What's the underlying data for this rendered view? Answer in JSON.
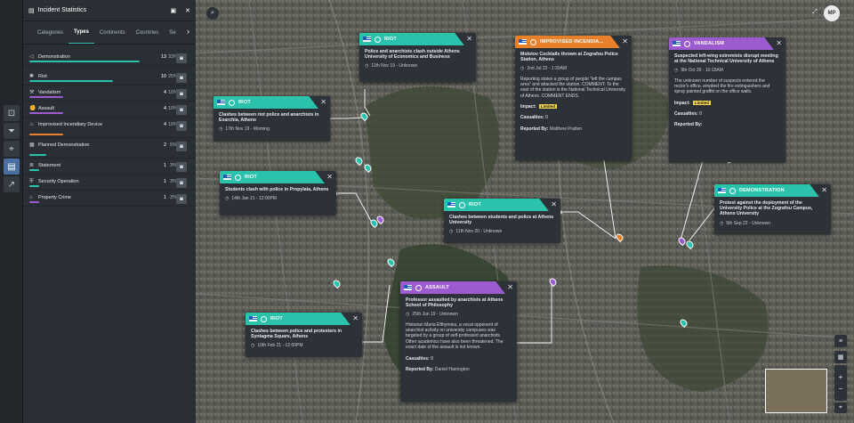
{
  "panel": {
    "title": "Incident Statistics",
    "tabs": [
      {
        "label": "Categories",
        "active": false
      },
      {
        "label": "Types",
        "active": true
      },
      {
        "label": "Continents",
        "active": false
      },
      {
        "label": "Countries",
        "active": false
      },
      {
        "label": "Se",
        "active": false
      }
    ],
    "rows": [
      {
        "label": "Demonstration",
        "icon": "megaphone-icon",
        "count": "13",
        "pct": "33%",
        "bar_color": "#2bc2ac",
        "share": 0.33
      },
      {
        "label": "Riot",
        "icon": "riot-icon",
        "count": "10",
        "pct": "25%",
        "bar_color": "#2bc2ac",
        "share": 0.25
      },
      {
        "label": "Vandalism",
        "icon": "hammer-icon",
        "count": "4",
        "pct": "10%",
        "bar_color": "#9c5cd0",
        "share": 0.1
      },
      {
        "label": "Assault",
        "icon": "fist-icon",
        "count": "4",
        "pct": "10%",
        "bar_color": "#9c5cd0",
        "share": 0.1
      },
      {
        "label": "Improvised Incendiary Device",
        "icon": "fire-icon",
        "count": "4",
        "pct": "10%",
        "bar_color": "#e8802c",
        "share": 0.1
      },
      {
        "label": "Planned Demonstration",
        "icon": "calendar-icon",
        "count": "2",
        "pct": "5%",
        "bar_color": "#2bc2ac",
        "share": 0.05
      },
      {
        "label": "Statement",
        "icon": "document-icon",
        "count": "1",
        "pct": "3%",
        "bar_color": "#2bc2ac",
        "share": 0.03
      },
      {
        "label": "Security Operation",
        "icon": "shield-icon",
        "count": "1",
        "pct": "3%",
        "bar_color": "#2bc2ac",
        "share": 0.03
      },
      {
        "label": "Property Crime",
        "icon": "house-icon",
        "count": "1",
        "pct": "3%",
        "bar_color": "#9c5cd0",
        "share": 0.03
      }
    ]
  },
  "user": {
    "initials": "MP"
  },
  "colors": {
    "riot": "#2bc2ac",
    "demonstration": "#2bc2ac",
    "vandalism": "#9c5cd0",
    "assault": "#9c5cd0",
    "incendiary": "#e8802c"
  },
  "cards": [
    {
      "type": "RIOT",
      "title": "Police and anarchists clash outside Athens University of Economics and Business",
      "time": "11th Nov 19 - Unknown"
    },
    {
      "type": "RIOT",
      "title": "Clashes between riot police and anarchists in Exarchia, Athens",
      "time": "17th Nov 19 - Morning"
    },
    {
      "type": "RIOT",
      "title": "Students clash with police in Propylaia, Athens",
      "time": "14th Jan 21 - 12:00PM"
    },
    {
      "type": "RIOT",
      "title": "Clashes between students and police at Athens University",
      "time": "11th Nov 20 - Unknown"
    },
    {
      "type": "RIOT",
      "title": "Clashes between police and protesters in Syntagma Square, Athens",
      "time": "10th Feb 21 - 12:00PM"
    },
    {
      "type": "IMPROVISED INCENDIA...",
      "title": "Molotov Cocktails thrown at Zografou Police Station, Athens",
      "time": "2nd Jul 22 - 1:30AM",
      "desc": "Reporting states a group of people \"left the campus area\" and attacked the station. COMMENT: To the east of the station is the National Technical University of Athens. COMMENT ENDS.",
      "impact_label": "Impact:",
      "impact": "Limited",
      "casualties_label": "Casualties:",
      "casualties": "0",
      "reported_label": "Reported By:",
      "reported": "Matthew Pratten"
    },
    {
      "type": "VANDALISM",
      "title": "Suspected left-wing extremists disrupt meeting at the National Technical University of Athens",
      "time": "9th Oct 20 - 10:15AM",
      "desc": "The unknown number of suspects entered the rector's office, emptied the fire extinguishers and spray painted graffiti on the office walls.",
      "impact_label": "Impact:",
      "impact": "Limited",
      "casualties_label": "Casualties:",
      "casualties": "0",
      "reported_label": "Reported By:",
      "reported": ""
    },
    {
      "type": "DEMONSTRATION",
      "title": "Protest against the deployment of the University Police at the Zografou Campus, Athens University",
      "time": "5th Sep 22 - Unknown"
    },
    {
      "type": "ASSAULT",
      "title": "Professor assaulted by anarchists at Athens School of Philosophy",
      "time": "25th Jun 19 - Unknown",
      "desc": "Historian Maria Efthymiou, a vocal opponent of anarchist activity on university campuses was targeted by a group of self-professed anarchists. Other academics have also been threatened. The exact date of the assault is not known.",
      "casualties_label": "Casualties:",
      "casualties": "0",
      "reported_label": "Reported By:",
      "reported": "Daniel Harrington"
    }
  ]
}
